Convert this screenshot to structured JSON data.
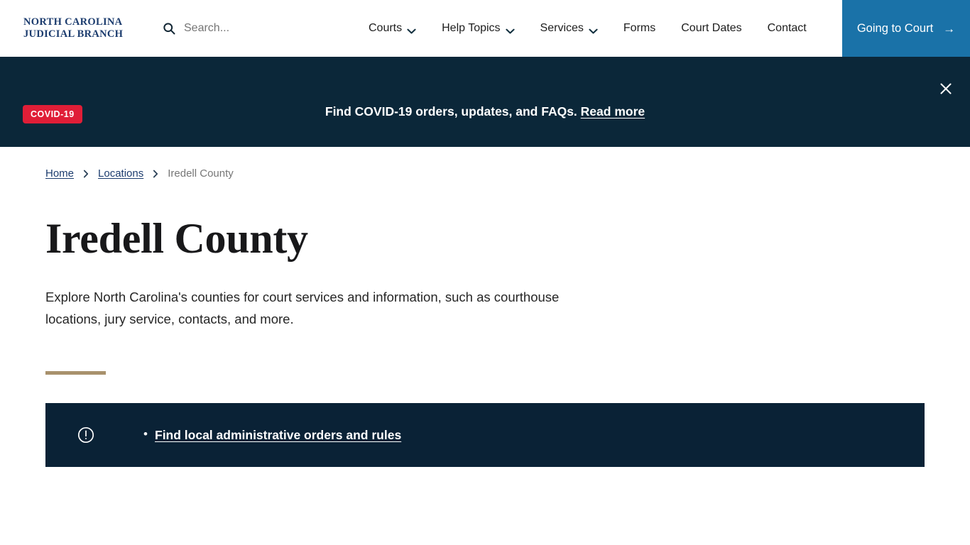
{
  "header": {
    "logo_line1": "NORTH CAROLINA",
    "logo_line2": "JUDICIAL BRANCH",
    "search_placeholder": "Search...",
    "search_value": "",
    "nav": [
      {
        "label": "Courts",
        "has_dropdown": true
      },
      {
        "label": "Help Topics",
        "has_dropdown": true
      },
      {
        "label": "Services",
        "has_dropdown": true
      },
      {
        "label": "Forms",
        "has_dropdown": false
      },
      {
        "label": "Court Dates",
        "has_dropdown": false
      },
      {
        "label": "Contact",
        "has_dropdown": false
      }
    ],
    "cta_label": "Going to Court",
    "cta_arrow": "→",
    "cta_color": "#1a72a8"
  },
  "banner": {
    "badge": "COVID-19",
    "badge_color": "#e01e37",
    "background": "#0b2739",
    "text": "Find COVID-19 orders, updates, and FAQs.",
    "link_label": "Read more",
    "close_label": "Close"
  },
  "breadcrumb": {
    "items": [
      {
        "label": "Home",
        "current": false
      },
      {
        "label": "Locations",
        "current": false
      },
      {
        "label": "Iredell County",
        "current": true
      }
    ],
    "separator": "›"
  },
  "page": {
    "title": "Iredell County",
    "lede": "Explore North Carolina's counties for court services and information, such as courthouse locations, jury service, contacts, and more.",
    "divider_color": "#a8916c"
  },
  "alert": {
    "background": "#0a2236",
    "icon": "exclamation-circle-icon",
    "items": [
      {
        "label": "Find local administrative orders and rules"
      }
    ]
  }
}
